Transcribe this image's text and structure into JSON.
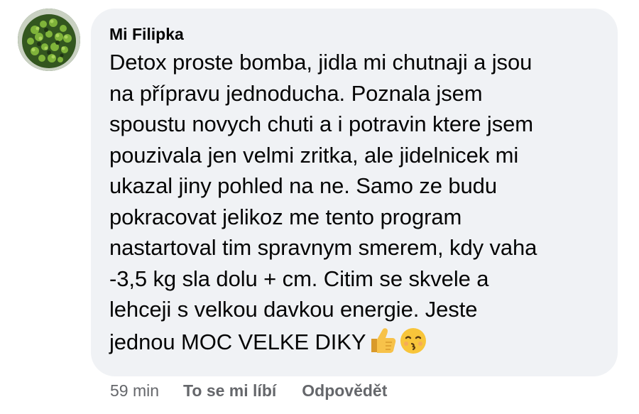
{
  "comment": {
    "author": "Mi Filipka",
    "lines": [
      "Detox proste bomba, jidla mi chutnaji a jsou",
      "na přípravu jednoducha. Poznala jsem",
      "spoustu novych chuti a i potravin ktere jsem",
      "pouzivala jen velmi zritka, ale jidelnicek mi",
      "ukazal jiny pohled na ne. Samo ze budu",
      "pokracovat jelikoz me tento program",
      "nastartoval tim spravnym smerem, kdy vaha",
      "-3,5 kg sla dolu + cm. Citim se skvele a",
      "lehceji s velkou davkou energie. Jeste",
      "jednou MOC VELKE DIKY"
    ],
    "emojis": [
      "thumbs-up-icon",
      "kissing-face-icon"
    ]
  },
  "actions": {
    "time": "59 min",
    "like": "To se mi líbí",
    "reply": "Odpovědět"
  },
  "colors": {
    "bubble": "#f0f2f5",
    "text": "#050505",
    "meta": "#65676b"
  }
}
